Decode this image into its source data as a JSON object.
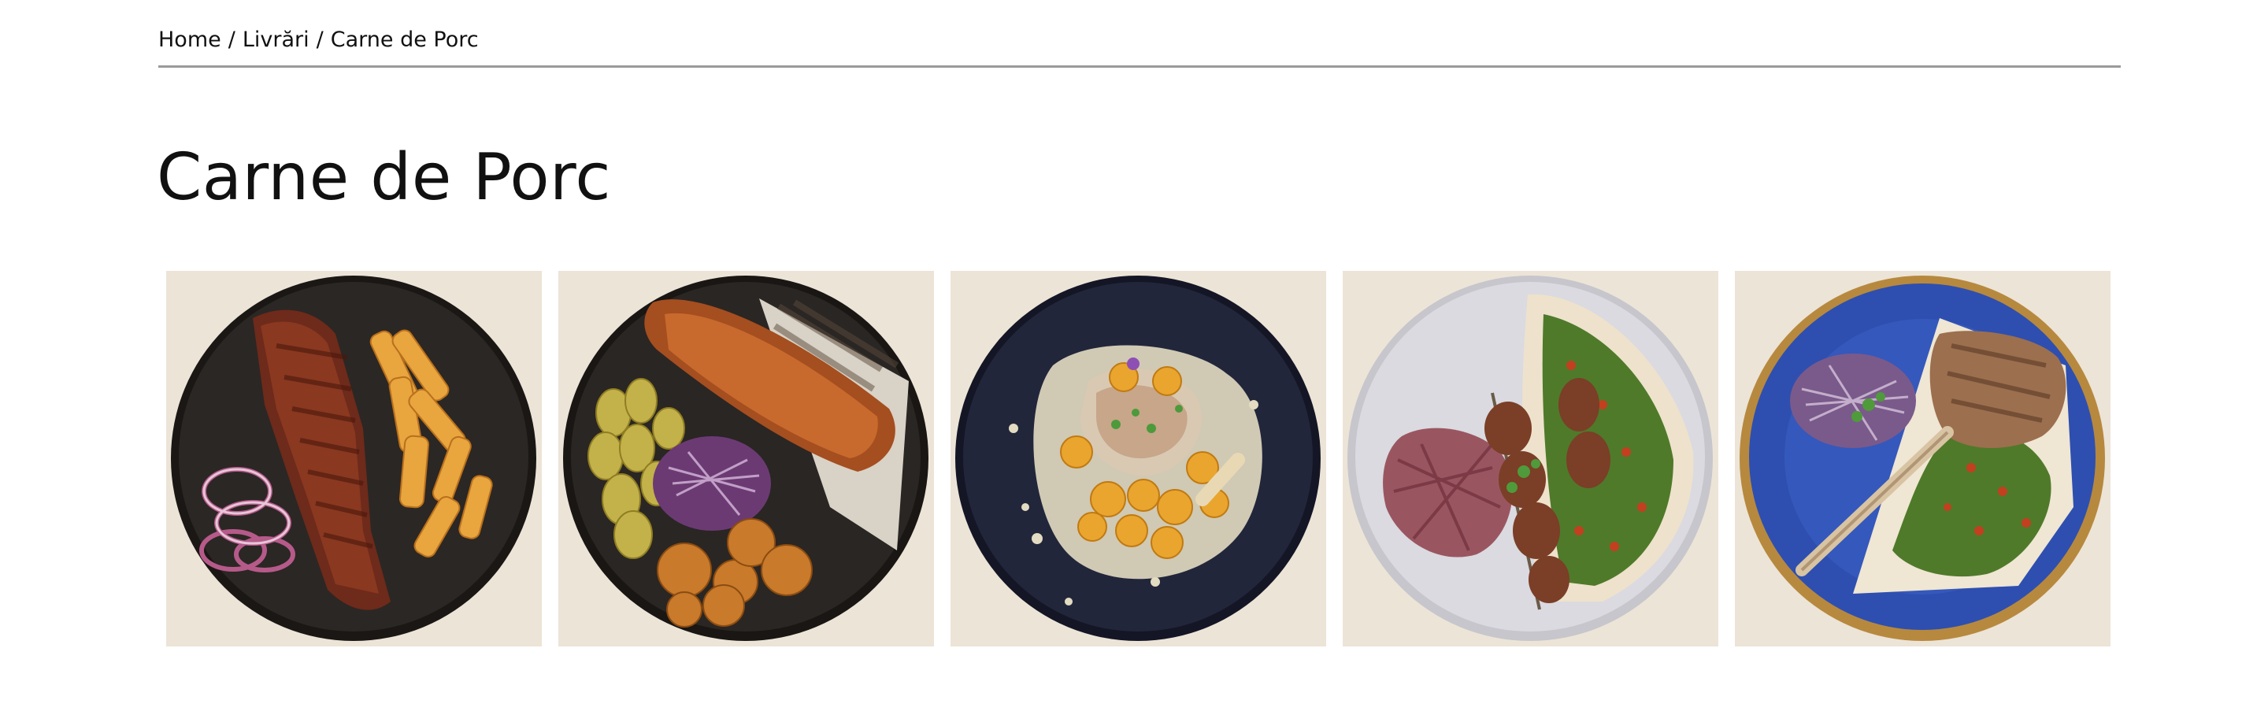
{
  "breadcrumb": {
    "items": [
      "Home",
      "Livrări",
      "Carne de Porc"
    ],
    "separator": "/"
  },
  "page": {
    "title": "Carne de Porc"
  },
  "gallery": {
    "items": [
      {
        "dish": "pork-ribs-fries-onion",
        "plate_color": "#24201e"
      },
      {
        "dish": "pork-belly-potatoes-slaw",
        "plate_color": "#252220"
      },
      {
        "dish": "pork-gnocchi-sauce",
        "plate_color": "#1e2235"
      },
      {
        "dish": "pork-skewers-flatbread",
        "plate_color": "#cfcfd6"
      },
      {
        "dish": "pork-tomahawk-flatbread",
        "plate_color": "#2e4fb0"
      }
    ]
  }
}
